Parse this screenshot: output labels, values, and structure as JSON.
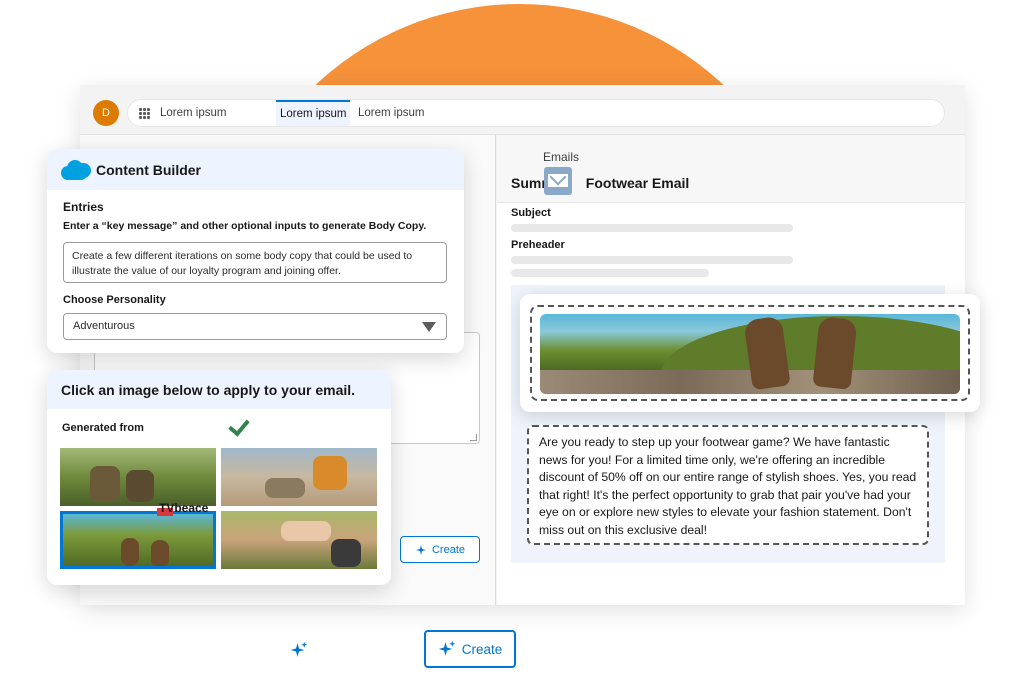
{
  "user": {
    "initial": "D"
  },
  "tabs": [
    {
      "label": "Lorem ipsum",
      "active": false
    },
    {
      "label": "Lorem ipsum",
      "active": true
    },
    {
      "label": "Lorem ipsum",
      "active": false
    }
  ],
  "content_builder": {
    "title": "Content Builder",
    "entries_label": "Entries",
    "instructions": "Enter a “key message” and other optional inputs to generate Body Copy.",
    "prompt_text": "Create a few different iterations on some body copy that could be used to illustrate the value of our loyalty program and joining offer.",
    "personality_label": "Choose Personality",
    "personality_value": "Adventurous"
  },
  "image_picker": {
    "heading": "Click an image below to apply to your email.",
    "generated_from": "Generated from",
    "overlay_text": "TVbeace"
  },
  "email": {
    "object_label": "Emails",
    "title_prefix": "Summ",
    "title_suffix": "Footwear Email",
    "subject_label": "Subject",
    "preheader_label": "Preheader",
    "body_copy": "Are you ready to step up your footwear game? We have fantastic news for you! For a limited time only, we're offering an incredible discount of 50% off on our entire range of stylish shoes. Yes, you read that right! It's the perfect opportunity to grab that pair you've had your eye on or explore new styles to elevate your fashion statement. Don't miss out on this exclusive deal!"
  },
  "buttons": {
    "create_inner": "Create",
    "create_bottom": "Create"
  },
  "colors": {
    "accent": "#0176d3",
    "orange": "#f6923a",
    "avatar": "#dd7a01",
    "success": "#2e844a"
  }
}
